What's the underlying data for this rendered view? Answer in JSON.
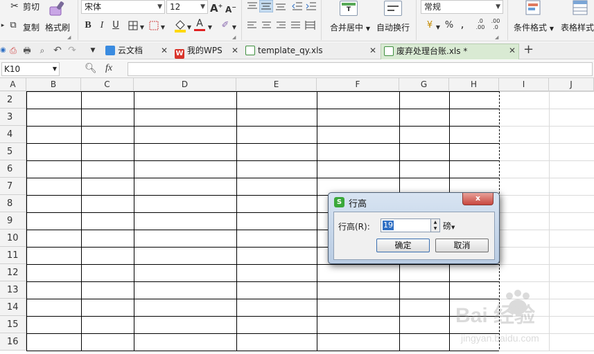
{
  "ribbon": {
    "cut": "剪切",
    "format_painter": "格式刷",
    "copy": "复制",
    "font_name": "宋体",
    "font_size": "12",
    "bold": "B",
    "italic": "I",
    "underline": "U",
    "grow_font": "A",
    "shrink_font": "A",
    "merge_center": "合并居中",
    "wrap_text": "自动换行",
    "number_format": "常规",
    "percent": "%",
    "conditional_format": "条件格式",
    "table_style": "表格样式"
  },
  "tabs": {
    "items": [
      {
        "label": "云文档"
      },
      {
        "label": "我的WPS"
      },
      {
        "label": "template_qy.xls"
      },
      {
        "label": "废弃处理台账.xls *"
      }
    ],
    "add": "+"
  },
  "formula_bar": {
    "name_box": "K10",
    "fx": "fx",
    "formula": ""
  },
  "grid": {
    "columns": [
      "A",
      "B",
      "C",
      "D",
      "E",
      "F",
      "G",
      "H",
      "I",
      "J"
    ],
    "rows": [
      "2",
      "3",
      "4",
      "5",
      "6",
      "7",
      "8",
      "9",
      "10",
      "11",
      "12",
      "13",
      "14",
      "15",
      "16"
    ]
  },
  "dialog": {
    "title": "行高",
    "field_label": "行高(R):",
    "value": "19",
    "unit": "磅",
    "ok": "确定",
    "cancel": "取消",
    "close": "x"
  },
  "watermark": {
    "text": "Bai 经验",
    "url": "jingyan.baidu.com"
  },
  "colors": {
    "active_tab": "#d9ead3",
    "dialog_frame": "#b9cce3",
    "close_button": "#c8473f",
    "wps_red": "#d9342b"
  }
}
